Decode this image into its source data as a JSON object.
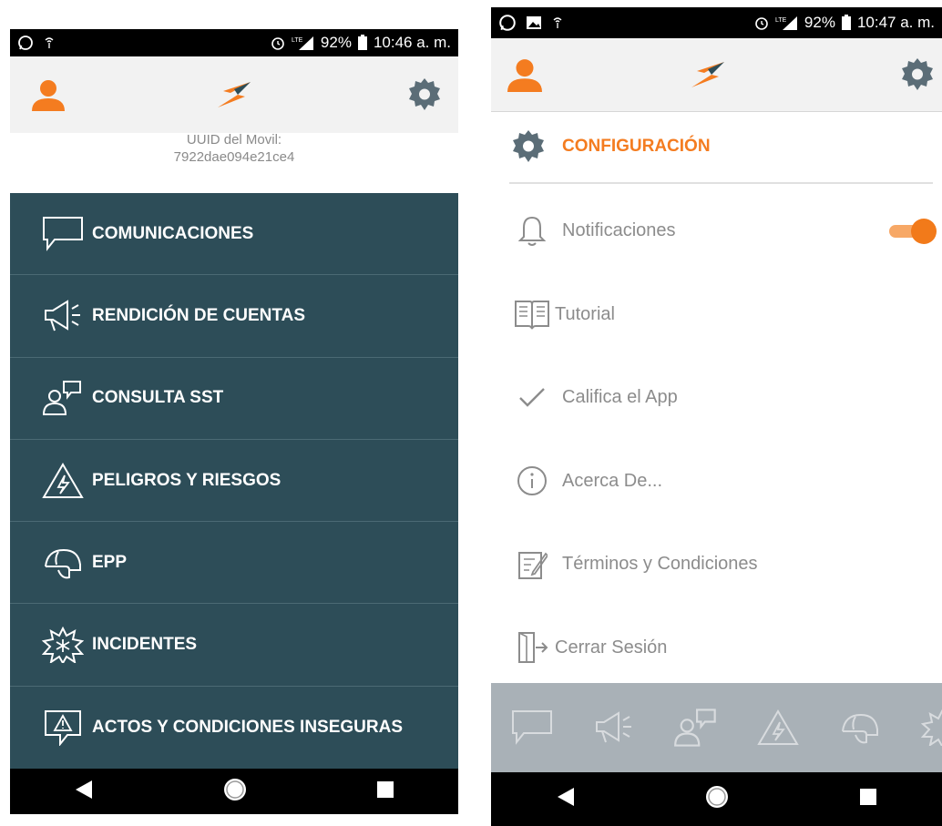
{
  "left_phone": {
    "status": {
      "battery": "92%",
      "time": "10:46 a. m.",
      "network": "LTE"
    },
    "uuid": {
      "label": "UUID del Movil:",
      "value": "7922dae094e21ce4"
    },
    "menu": [
      {
        "label": "COMUNICACIONES",
        "icon": "speech-bubble-icon"
      },
      {
        "label": "RENDICIÓN DE CUENTAS",
        "icon": "megaphone-icon"
      },
      {
        "label": "CONSULTA SST",
        "icon": "person-chat-icon"
      },
      {
        "label": "PELIGROS Y RIESGOS",
        "icon": "high-voltage-warning-icon"
      },
      {
        "label": "EPP",
        "icon": "hard-hat-icon"
      },
      {
        "label": "INCIDENTES",
        "icon": "burst-icon"
      },
      {
        "label": "ACTOS Y CONDICIONES INSEGURAS",
        "icon": "warning-screen-icon"
      }
    ]
  },
  "right_phone": {
    "status": {
      "battery": "92%",
      "time": "10:47 a. m.",
      "network": "LTE"
    },
    "config": {
      "title": "CONFIGURACIÓN"
    },
    "settings": [
      {
        "label": "Notificaciones",
        "icon": "bell-icon",
        "toggle_on": true
      },
      {
        "label": "Tutorial",
        "icon": "book-icon"
      },
      {
        "label": "Califica el App",
        "icon": "checkmark-icon"
      },
      {
        "label": "Acerca De...",
        "icon": "info-icon"
      },
      {
        "label": "Términos y Condiciones",
        "icon": "edit-document-icon"
      },
      {
        "label": "Cerrar Sesión",
        "icon": "logout-door-icon"
      }
    ]
  },
  "colors": {
    "accent": "#f47c20",
    "menu_bg": "#2d4d58",
    "appbar_bg": "#f2f2f2"
  }
}
